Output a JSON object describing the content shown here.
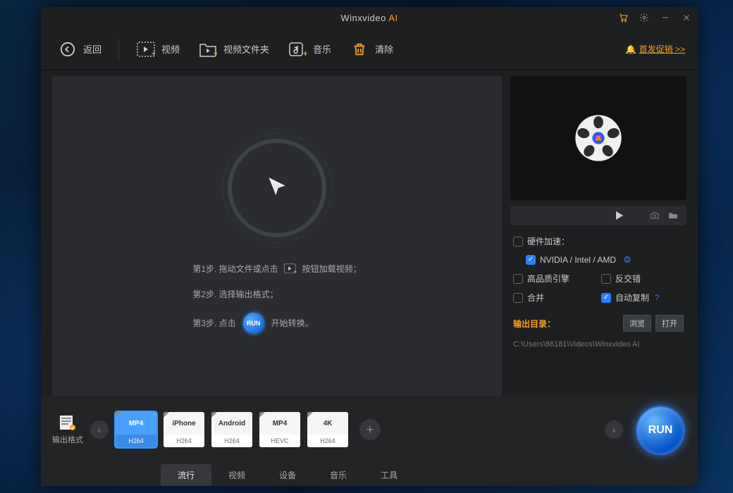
{
  "title": {
    "brand": "Winxvideo",
    "suffix": "AI"
  },
  "toolbar": {
    "back": "返回",
    "video": "视频",
    "folder": "视频文件夹",
    "music": "音乐",
    "clear": "清除",
    "promo": "首发促销 >>"
  },
  "steps": {
    "s1a": "第1步. 拖动文件或点击",
    "s1b": "按钮加载视频；",
    "s2": "第2步. 选择输出格式；",
    "s3a": "第3步. 点击",
    "s3b": "开始转换。",
    "run": "RUN"
  },
  "side": {
    "hwaccel_label": "硬件加速：",
    "hwaccel_opt": "NVIDIA / Intel / AMD",
    "hq_engine": "高品质引擎",
    "deinterlace": "反交错",
    "merge": "合并",
    "autocopy": "自动复制",
    "out_label": "输出目录：",
    "browse": "浏览",
    "open": "打开",
    "out_path": "C:\\Users\\86181\\Videos\\Winxvideo AI"
  },
  "formats_label": "输出格式",
  "formats": [
    {
      "top": "MP4",
      "bot": "H264",
      "selected": true
    },
    {
      "top": "iPhone",
      "bot": "H264",
      "selected": false
    },
    {
      "top": "Android",
      "bot": "H264",
      "selected": false
    },
    {
      "top": "MP4",
      "bot": "HEVC",
      "selected": false
    },
    {
      "top": "4K",
      "bot": "H264",
      "selected": false
    }
  ],
  "tabs": [
    "流行",
    "视频",
    "设备",
    "音乐",
    "工具"
  ],
  "active_tab": 0,
  "run_label": "RUN"
}
